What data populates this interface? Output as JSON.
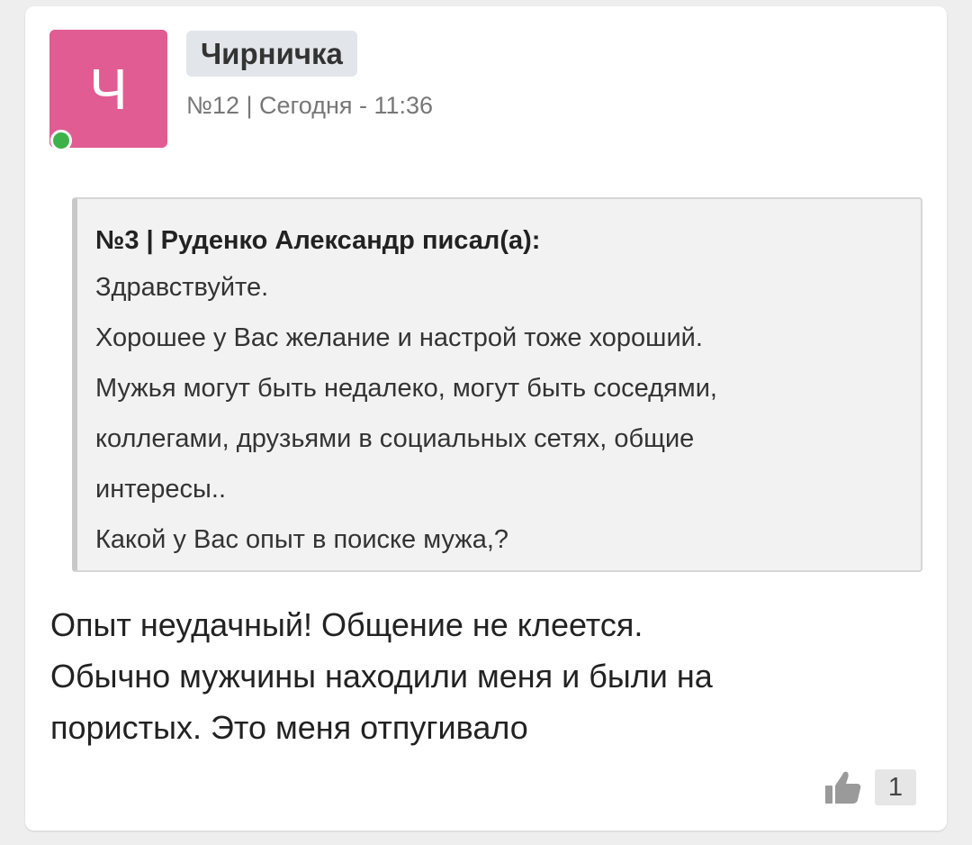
{
  "colors": {
    "avatar_bg": "#e05c93",
    "online_dot": "#3db248",
    "like_icon": "#9a9a9a"
  },
  "post": {
    "avatar_letter": "Ч",
    "author": "Чирничка",
    "meta": "№12 | Сегодня - 11:36",
    "online": true,
    "quote": {
      "header": "№3 | Руденко Александр писал(а):",
      "lines": [
        "Здравствуйте.",
        "Хорошее у Вас желание и настрой тоже хороший.",
        "Мужья могут быть недалеко, могут быть соседями,",
        "коллегами, друзьями в социальных сетях, общие",
        "интересы..",
        "Какой у Вас опыт в поиске мужа,?"
      ]
    },
    "message_lines": [
      "Опыт неудачный! Общение не клеется.",
      "Обычно мужчины находили меня и были на",
      "пористых. Это меня отпугивало"
    ],
    "like_icon": "thumbs-up-icon",
    "likes": "1"
  }
}
